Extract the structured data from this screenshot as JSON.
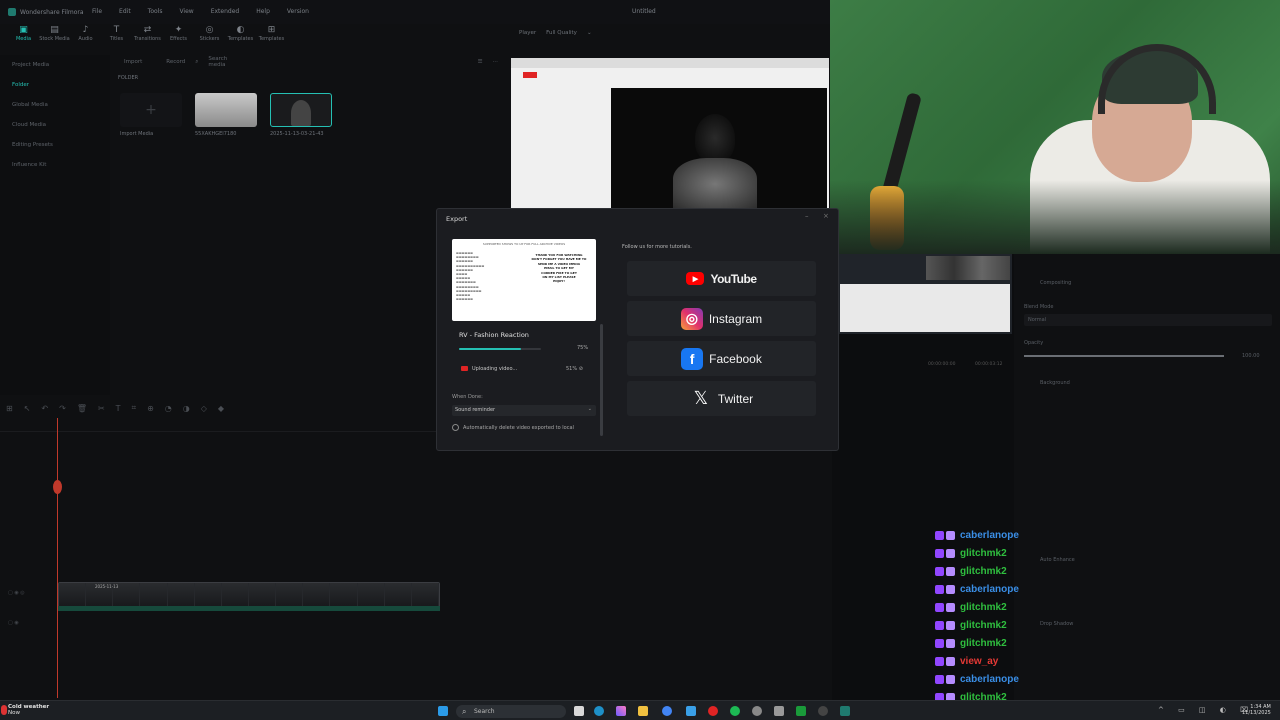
{
  "editor": {
    "app_name": "Wondershare Filmora",
    "menu": [
      "File",
      "Edit",
      "Tools",
      "View",
      "Extended",
      "Help",
      "Version"
    ],
    "window_title": "Untitled",
    "toolbar": [
      "Media",
      "Stock Media",
      "Audio",
      "Titles",
      "Transitions",
      "Effects",
      "Stickers",
      "Templates",
      "Templates"
    ],
    "sidebar": [
      "Project Media",
      "Folder",
      "Global Media",
      "Cloud Media",
      "Editing Presets",
      "Influence Kit"
    ],
    "media_toolbar": {
      "import": "Import",
      "record": "Record",
      "search_placeholder": "Search media"
    },
    "folder_label": "FOLDER",
    "import_media": "Import Media",
    "media_items": [
      "55XAKHGEI7180",
      "2025-11-13-03-21-43"
    ],
    "player_label": "Player",
    "quality": "Full Quality",
    "clip_label": "2025-11-13"
  },
  "export": {
    "title": "Export",
    "minimize": "–",
    "close": "×",
    "thumb_header": "SUPPORTED SHOWS TO UP FOR FULL ARCHIVE VIDEOS",
    "thumb_right": [
      "THANK YOU FOR WATCHING",
      "DON'T FORGET YOU HAVE ME TO",
      "SEND ME A VIDEO MEDIA",
      "EMAIL TO GET MY",
      "CORNER FIRE TO GET",
      "ON MY LIST PLEASE",
      "ENJOY!"
    ],
    "video_name": "RV - Fashion Reaction",
    "progress_label": "75%",
    "progress": 0.75,
    "upload_status": "Uploading video...",
    "upload_percent": "51%",
    "when_done_label": "When Done:",
    "when_done_value": "Sound reminder",
    "auto_delete": "Automatically delete video exported to local",
    "follow_text": "Follow us for more tutorials.",
    "socials": [
      "YouTube",
      "Instagram",
      "Facebook",
      "Twitter"
    ]
  },
  "right_panel": {
    "compositing": "Compositing",
    "blend_mode": "Blend Mode",
    "blend_value": "Normal",
    "opacity": "Opacity",
    "opacity_value": "100.00",
    "background": "Background",
    "auto_enhance": "Auto Enhance",
    "drop_shadow": "Drop Shadow",
    "timecode": "00:00:00:00",
    "timecode2": "00:00:03:12"
  },
  "chat": [
    {
      "name": "caberlanope",
      "color": "#3a8ee6"
    },
    {
      "name": "glitchmk2",
      "color": "#2fbf3f"
    },
    {
      "name": "glitchmk2",
      "color": "#2fbf3f"
    },
    {
      "name": "caberlanope",
      "color": "#3a8ee6"
    },
    {
      "name": "glitchmk2",
      "color": "#2fbf3f"
    },
    {
      "name": "glitchmk2",
      "color": "#2fbf3f"
    },
    {
      "name": "glitchmk2",
      "color": "#2fbf3f"
    },
    {
      "name": "view_ay",
      "color": "#e53935"
    },
    {
      "name": "caberlanope",
      "color": "#3a8ee6"
    },
    {
      "name": "glitchmk2",
      "color": "#2fbf3f"
    }
  ],
  "taskbar": {
    "weather_title": "Cold weather",
    "weather_sub": "Now",
    "search_placeholder": "Search",
    "time": "1:34 AM",
    "date": "11/13/2025"
  },
  "colors": {
    "accent": "#25c0b3",
    "youtube": "#ff0000",
    "facebook": "#1877f2"
  }
}
